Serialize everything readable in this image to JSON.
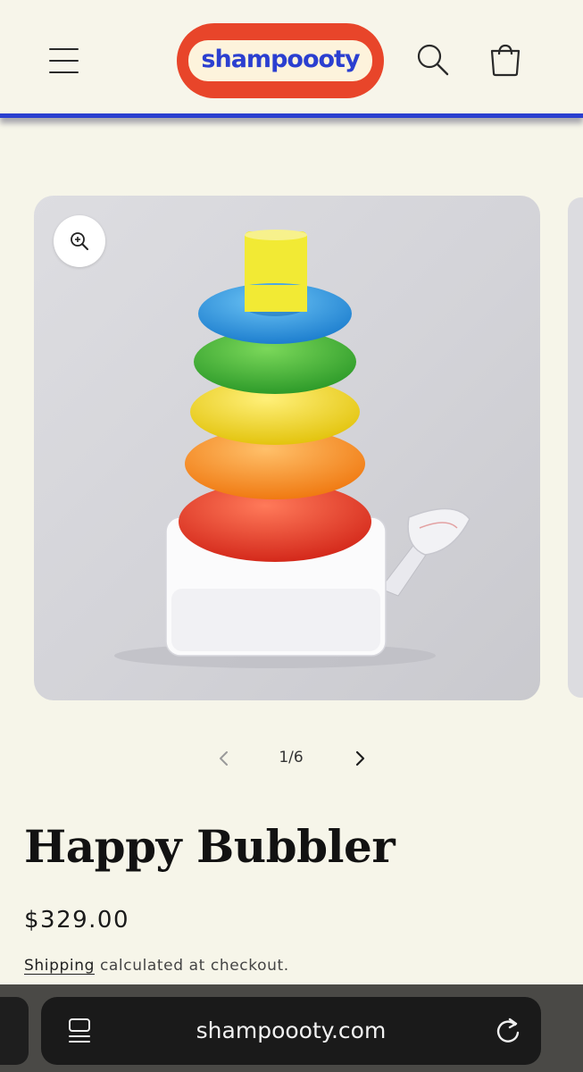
{
  "header": {
    "logo_text": "shampoooty",
    "icons": [
      "hamburger-menu-icon",
      "search-icon",
      "cart-icon"
    ],
    "colors": {
      "logo_red": "#e8452a",
      "logo_blue": "#2b3fd0",
      "header_border": "#2a3fcf"
    }
  },
  "gallery": {
    "zoom_icon": "zoom-in-icon",
    "image_alt": "Rainbow stacking-ring bubbler on white base with glass bowl",
    "pager": {
      "current": "1/6",
      "prev_icon": "chevron-left-icon",
      "next_icon": "chevron-right-icon"
    }
  },
  "product": {
    "title": "Happy Bubbler",
    "price": "$329.00",
    "shipping_link": "Shipping",
    "shipping_note": " calculated at checkout."
  },
  "browser": {
    "url": "shampoooty.com",
    "icons": [
      "page-menu-icon",
      "reload-icon"
    ]
  }
}
